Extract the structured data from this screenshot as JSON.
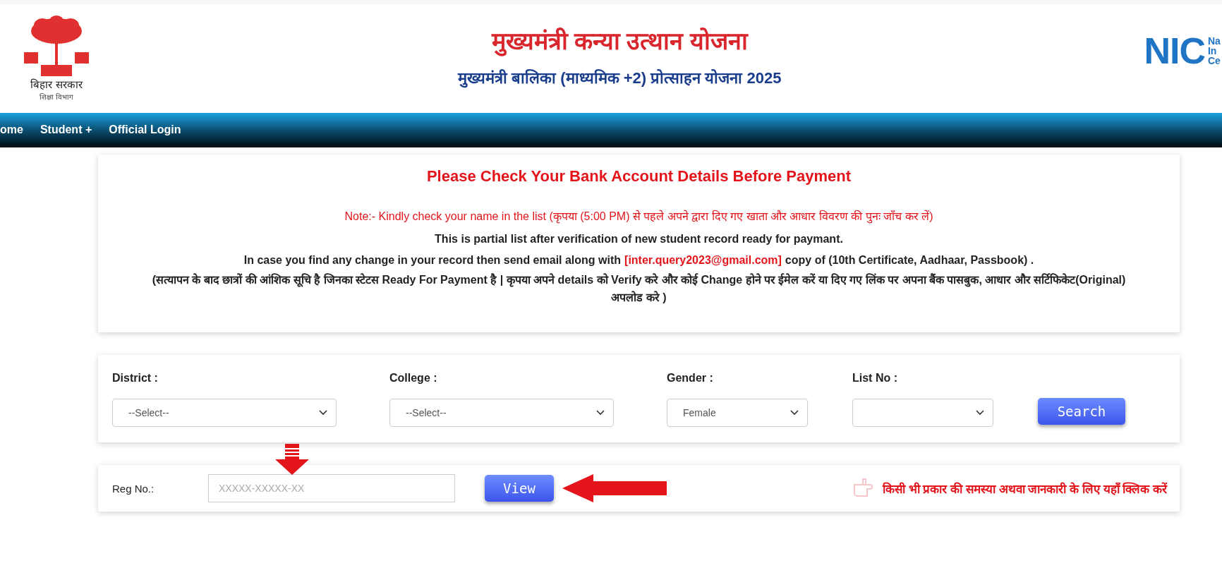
{
  "header": {
    "logo_caption": "बिहार सरकार",
    "logo_subcaption": "शिक्षा विभाग",
    "title": "मुख्यमंत्री कन्या उत्थान योजना",
    "subtitle": "मुख्यमंत्री बालिका (माध्यमिक +2) प्रोत्साहन योजना 2025",
    "nic_logo": "NIC",
    "nic_lines": [
      "Na",
      "In",
      "Ce"
    ]
  },
  "nav": {
    "items": [
      {
        "label": "ome",
        "selected": false
      },
      {
        "label": "Student +",
        "selected": false
      },
      {
        "label": "Official Login",
        "selected": false
      }
    ]
  },
  "notice": {
    "heading": "Please Check Your Bank Account Details Before Payment",
    "note": "Note:-  Kindly check your name in the list (कृपया (5:00 PM) से पहले अपने द्वारा दिए गए खाता और आधार विवरण की पुनः जाँच कर लें)",
    "partial": "This is partial list after verification of new student record ready for paymant.",
    "email_before": "In case you find any change in your record then send email along with",
    "email": "[inter.query2023@gmail.com]",
    "email_after": "copy of (10th Certificate, Aadhaar, Passbook) .",
    "hindi": "(सत्यापन के बाद छात्रों की आंशिक सूचि है जिनका स्टेटस Ready For Payment है | कृपया अपने details को Verify करे और कोई Change होने पर ईमेल करें या दिए गए लिंक पर अपना बैंक पासबुक, आधार और सर्टिफिकेट(Original) अपलोड करे )"
  },
  "filters": [
    {
      "label": "District :",
      "value": "--Select--"
    },
    {
      "label": "College :",
      "value": "--Select--"
    },
    {
      "label": "Gender :",
      "value": "Female"
    },
    {
      "label": "List No :"
    }
  ],
  "search_button": "Search",
  "reg": {
    "label": "Reg No.:",
    "placeholder": "XXXXX-XXXXX-XX",
    "button": "View",
    "help_link": "किसी भी प्रकार की समस्या अथवा जानकारी के लिए यहाँ क्लिक करें"
  }
}
